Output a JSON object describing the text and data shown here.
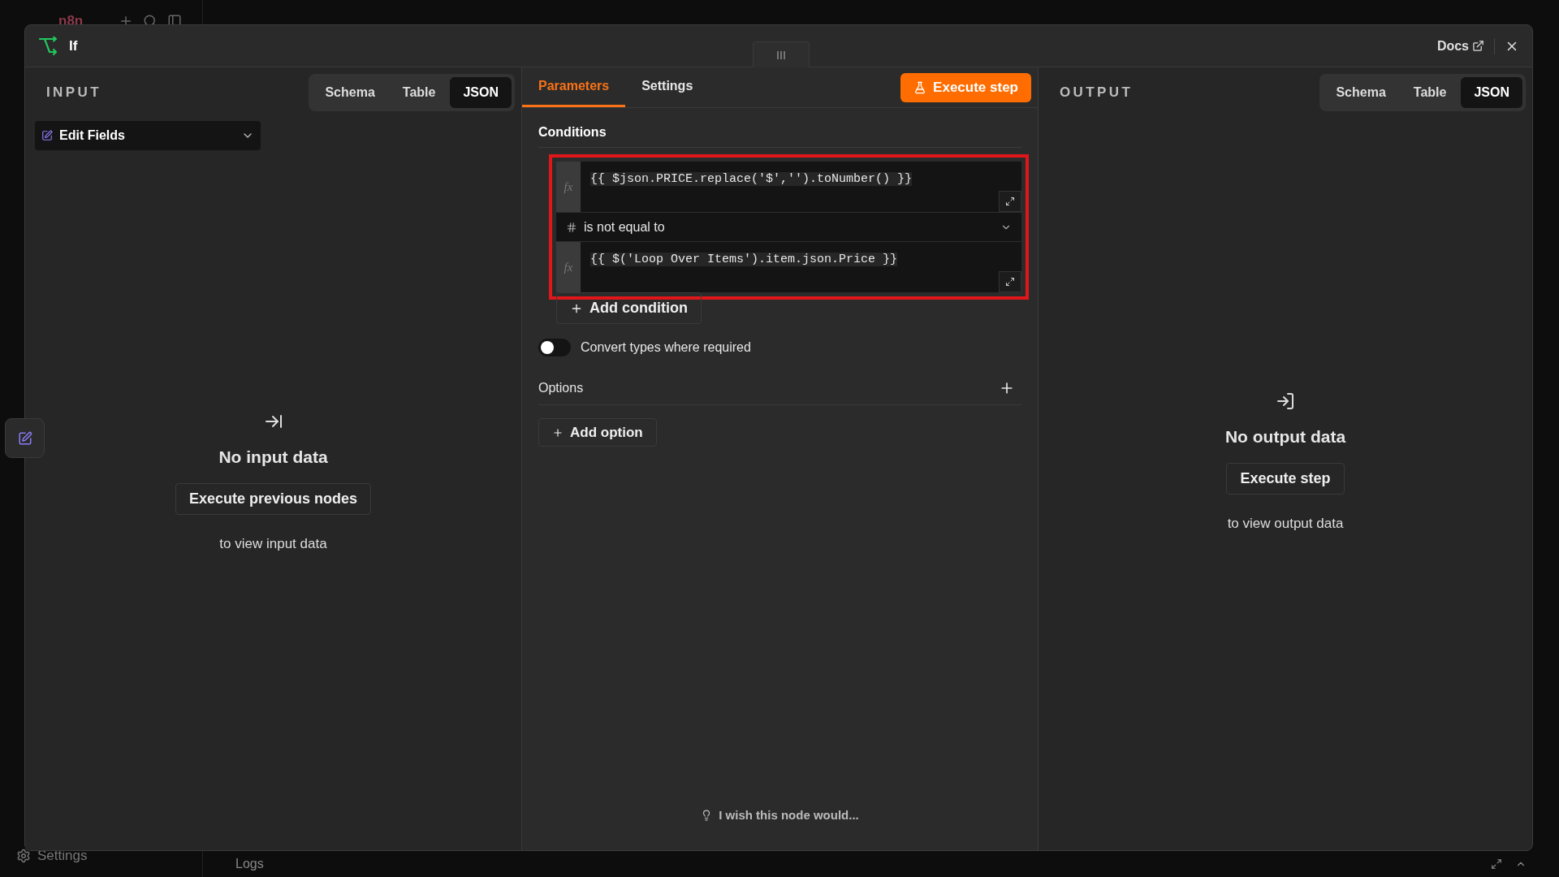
{
  "app": {
    "logo": "n8n",
    "settings": "Settings",
    "logs": "Logs"
  },
  "dialog": {
    "title": "If",
    "docs": "Docs"
  },
  "input": {
    "label": "INPUT",
    "view_tabs": [
      {
        "label": "Schema",
        "selected": false
      },
      {
        "label": "Table",
        "selected": false
      },
      {
        "label": "JSON",
        "selected": true
      }
    ],
    "source": "Edit Fields",
    "empty_title": "No input data",
    "action": "Execute previous nodes",
    "hint": "to view input data"
  },
  "params": {
    "tabs": [
      {
        "label": "Parameters",
        "selected": true
      },
      {
        "label": "Settings",
        "selected": false
      }
    ],
    "execute": "Execute step",
    "conditions_label": "Conditions",
    "conditions": [
      {
        "left_fx": "fx",
        "right_fx": "fx",
        "left": "{{ $json.PRICE.replace('$','').toNumber() }}",
        "operator": "is not equal to",
        "right": "{{ $('Loop Over Items').item.json.Price }}",
        "highlighted": true
      }
    ],
    "add_condition": "Add condition",
    "convert_types": {
      "label": "Convert types where required",
      "on": false
    },
    "options_label": "Options",
    "add_option": "Add option",
    "feedback": "I wish this node would..."
  },
  "output": {
    "label": "OUTPUT",
    "view_tabs": [
      {
        "label": "Schema",
        "selected": false
      },
      {
        "label": "Table",
        "selected": false
      },
      {
        "label": "JSON",
        "selected": true
      }
    ],
    "empty_title": "No output data",
    "action": "Execute step",
    "hint": "to view output data"
  }
}
